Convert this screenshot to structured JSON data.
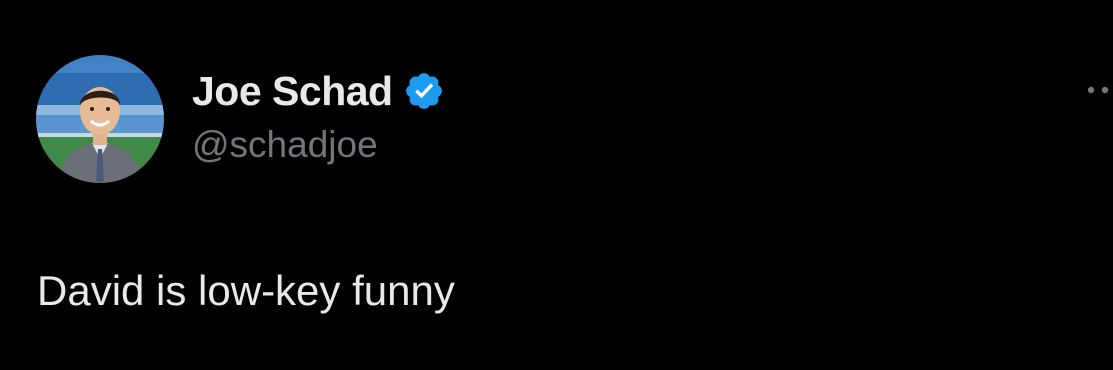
{
  "tweet": {
    "author": {
      "display_name": "Joe Schad",
      "handle": "@schadjoe",
      "verified": true,
      "avatar_icon": "profile-photo",
      "verified_icon": "verified-badge-icon"
    },
    "text": "David is low-key funny",
    "menu_icon": "more-options-icon"
  },
  "colors": {
    "background": "#000000",
    "primary_text": "#e7e9ea",
    "secondary_text": "#71767b",
    "verified_blue": "#1d9bf0"
  }
}
